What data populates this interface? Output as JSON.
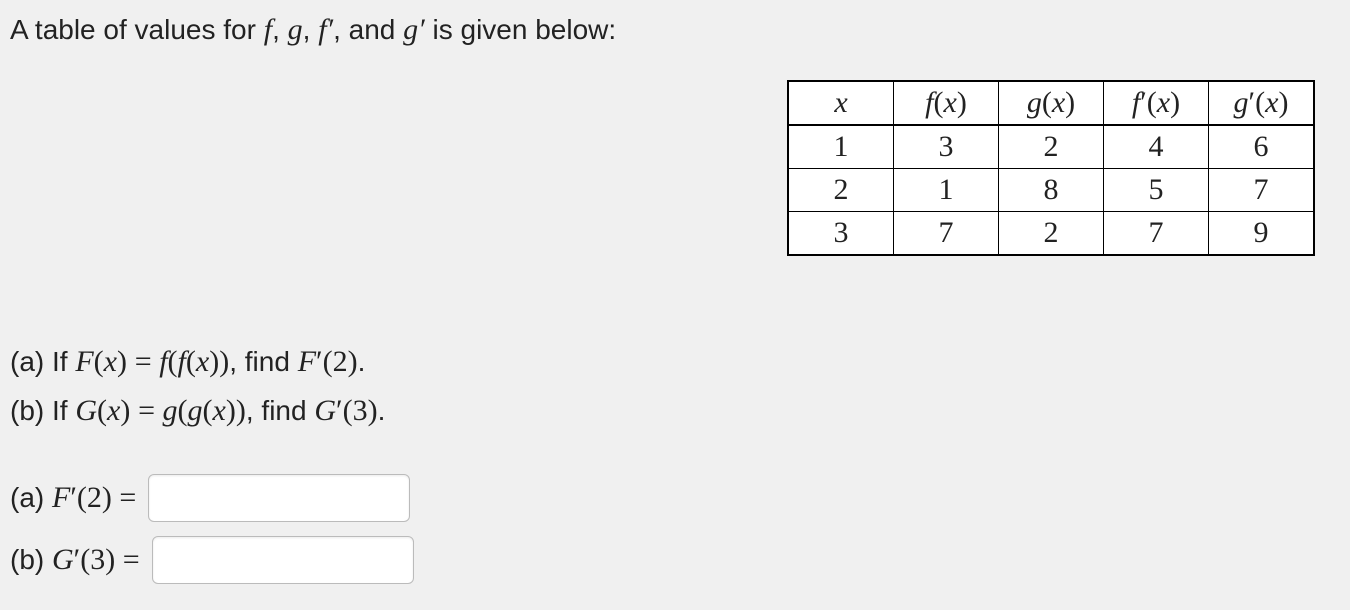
{
  "prompt": {
    "pre": "A table of values for ",
    "f": "f",
    "sep1": ", ",
    "g": "g",
    "sep2": ", ",
    "fprime": "f′",
    "sep3": ", and ",
    "gprime": "g′",
    "post": " is given below:"
  },
  "table": {
    "headers": {
      "x": "x",
      "fx_f": "f",
      "fx_of": "(",
      "fx_x": "x",
      "fx_cl": ")",
      "gx_g": "g",
      "gx_of": "(",
      "gx_x": "x",
      "gx_cl": ")",
      "fpx_f": "f",
      "fpx_pr": "′",
      "fpx_of": "(",
      "fpx_x": "x",
      "fpx_cl": ")",
      "gpx_g": "g",
      "gpx_pr": "′",
      "gpx_of": "(",
      "gpx_x": "x",
      "gpx_cl": ")"
    },
    "rows": [
      {
        "x": "1",
        "fx": "3",
        "gx": "2",
        "fpx": "4",
        "gpx": "6"
      },
      {
        "x": "2",
        "fx": "1",
        "gx": "8",
        "fpx": "5",
        "gpx": "7"
      },
      {
        "x": "3",
        "fx": "7",
        "gx": "2",
        "fpx": "7",
        "gpx": "9"
      }
    ]
  },
  "questions": {
    "a": {
      "label": "(a) If ",
      "F": "F",
      "of": "(",
      "x1": "x",
      "cl": ")",
      "eq": " = ",
      "f_outer": "f",
      "op2": "(",
      "f_inner": "f",
      "op3": "(",
      "x2": "x",
      "cl2": "))",
      "mid": ", find ",
      "F2": "F",
      "pr": "′",
      "op4": "(",
      "two": "2",
      "cl3": ")",
      "dot": "."
    },
    "b": {
      "label": "(b) If ",
      "G": "G",
      "of": "(",
      "x1": "x",
      "cl": ")",
      "eq": " = ",
      "g_outer": "g",
      "op2": "(",
      "g_inner": "g",
      "op3": "(",
      "x2": "x",
      "cl2": "))",
      "mid": ", find ",
      "G2": "G",
      "pr": "′",
      "op4": "(",
      "three": "3",
      "cl3": ")",
      "dot": "."
    }
  },
  "answers": {
    "a": {
      "label_pre": "(a) ",
      "F": "F",
      "pr": "′",
      "op": "(",
      "two": "2",
      "cl": ")",
      "eq": " = ",
      "value": ""
    },
    "b": {
      "label_pre": "(b) ",
      "G": "G",
      "pr": "′",
      "op": "(",
      "three": "3",
      "cl": ")",
      "eq": " = ",
      "value": ""
    }
  },
  "chart_data": {
    "type": "table",
    "columns": [
      "x",
      "f(x)",
      "g(x)",
      "f'(x)",
      "g'(x)"
    ],
    "rows": [
      [
        1,
        3,
        2,
        4,
        6
      ],
      [
        2,
        1,
        8,
        5,
        7
      ],
      [
        3,
        7,
        2,
        7,
        9
      ]
    ]
  }
}
